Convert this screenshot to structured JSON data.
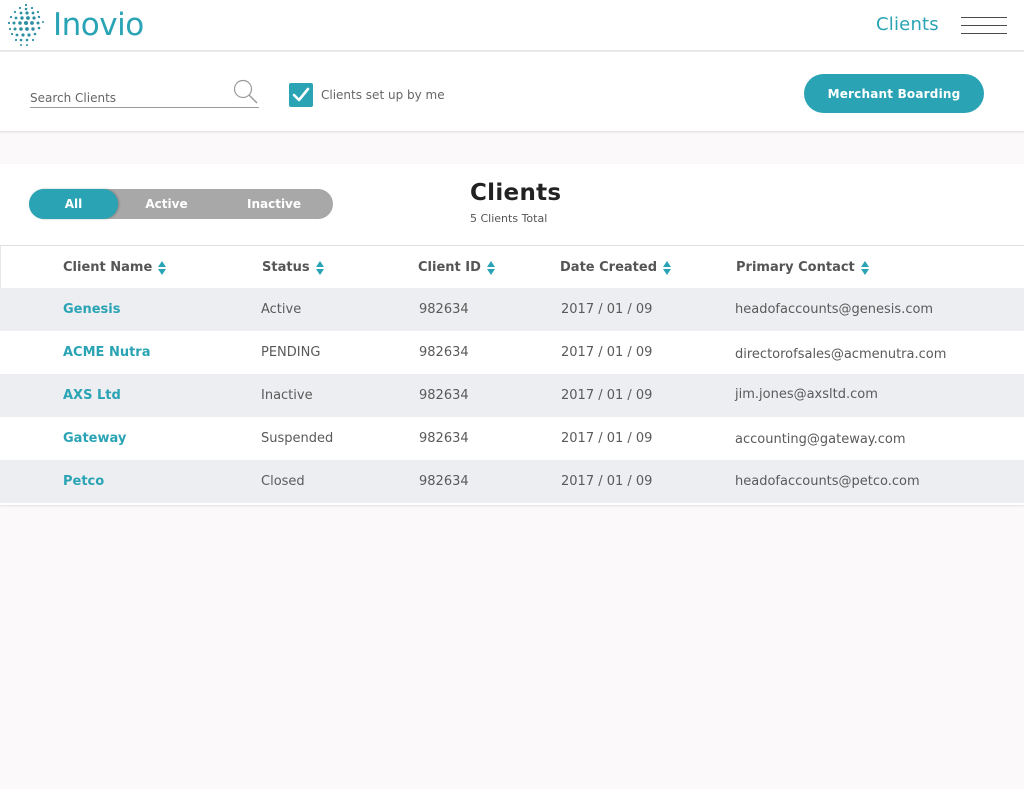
{
  "app": {
    "logo_text": "Inovio",
    "page_title": "Clients"
  },
  "icons": {
    "logo": "inovio-dot-globe-logo",
    "menu": "hamburger-menu-icon",
    "search": "search-icon",
    "check": "checkmark-icon",
    "sort": "sort-arrows-icon"
  },
  "colors": {
    "accent": "#2aa4b4",
    "segment_bg": "#a8a8a8",
    "row_alt": "#eceef1",
    "page_bg": "#fbf9f9"
  },
  "toolbar": {
    "search_placeholder": "Search Clients",
    "checkbox_label": "Clients set up by me",
    "checkbox_checked": true,
    "merchant_button": "Merchant Boarding"
  },
  "filters": {
    "selected": "All",
    "items": [
      {
        "label": "All"
      },
      {
        "label": "Active"
      },
      {
        "label": "Inactive"
      }
    ]
  },
  "panel": {
    "title": "Clients",
    "subtitle": "5 Clients Total"
  },
  "table": {
    "columns": [
      "Client Name",
      "Status",
      "Client ID",
      "Date Created",
      "Primary Contact"
    ],
    "rows": [
      {
        "name": "Genesis",
        "status": "Active",
        "id": "982634",
        "date": "2017 / 01 / 09",
        "contact": "headofaccounts@genesis.com"
      },
      {
        "name": "ACME Nutra",
        "status": "PENDING",
        "id": "982634",
        "date": "2017 / 01 / 09",
        "contact": "directorofsales@acmenutra.com"
      },
      {
        "name": "AXS Ltd",
        "status": "Inactive",
        "id": "982634",
        "date": "2017 / 01 / 09",
        "contact": "jim.jones@axsltd.com"
      },
      {
        "name": "Gateway",
        "status": "Suspended",
        "id": "982634",
        "date": "2017 / 01 / 09",
        "contact": "accounting@gateway.com"
      },
      {
        "name": "Petco",
        "status": "Closed",
        "id": "982634",
        "date": "2017 / 01 / 09",
        "contact": "headofaccounts@petco.com"
      }
    ]
  }
}
